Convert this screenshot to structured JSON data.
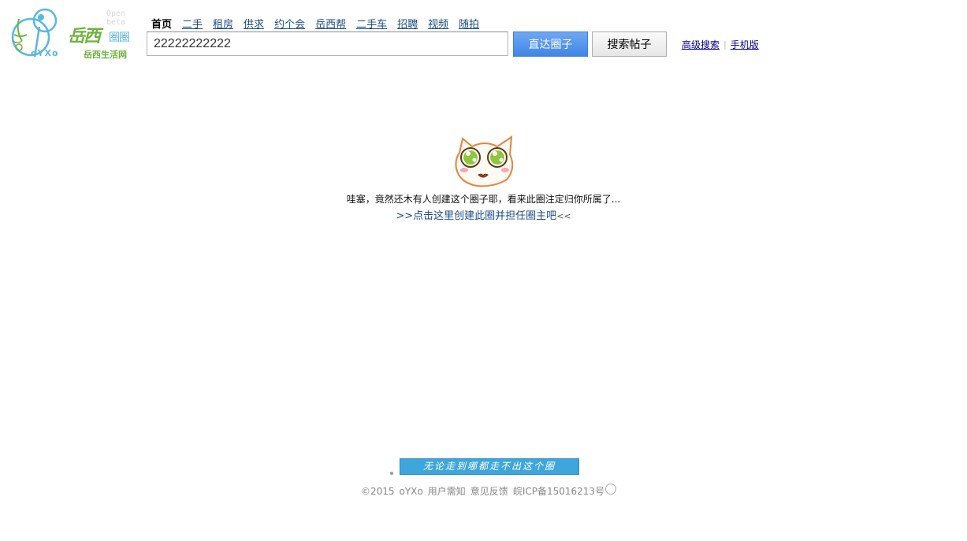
{
  "logo": {
    "open_beta": "Open beta",
    "name_cn": "岳西",
    "quan": "圈圈",
    "oyxo": "oYXo",
    "subtitle": "岳西生活网"
  },
  "nav": {
    "items": [
      "首页",
      "二手",
      "租房",
      "供求",
      "约个会",
      "岳西帮",
      "二手车",
      "招聘",
      "视频",
      "随拍"
    ]
  },
  "search": {
    "value": "22222222222",
    "goto_label": "直达圈子",
    "search_label": "搜索帖子"
  },
  "extra_links": {
    "advanced": "高级搜索",
    "separator": "|",
    "mobile": "手机版"
  },
  "empty": {
    "message": "哇塞，竟然还木有人创建这个圈子耶，看来此圈注定归你所属了...",
    "create_link": ">>点击这里创建此圈并担任圈主吧",
    "create_tail": "<<"
  },
  "footer": {
    "banner": "无论走到哪都走不出这个圈",
    "copyright": "©2015",
    "brand": "oYXo",
    "terms": "用户需知",
    "feedback": "意见反馈",
    "icp": "皖ICP备15016213号"
  },
  "colors": {
    "brand_green": "#6db33f",
    "brand_blue": "#59b7e6",
    "link": "#1a4a8a",
    "button_blue": "#3f85e6"
  }
}
